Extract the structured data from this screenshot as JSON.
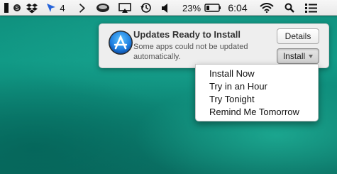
{
  "menubar": {
    "icons": [
      "dropbox-icon",
      "cursor-arrow-icon",
      "forward-icon",
      "coffee-cup-icon",
      "airplay-icon",
      "time-machine-icon",
      "volume-icon",
      "battery-icon",
      "wifi-icon",
      "search-icon",
      "list-icon"
    ],
    "badge_count": "4",
    "battery_percent": "23%",
    "battery_level": 0.23,
    "clock": "6:04"
  },
  "notification": {
    "app_icon": "app-store-icon",
    "title": "Updates Ready to Install",
    "body": "Some apps could not be updated automatically.",
    "details_label": "Details",
    "install_label": "Install"
  },
  "install_menu": {
    "items": [
      {
        "label": "Install Now"
      },
      {
        "label": "Try in an Hour"
      },
      {
        "label": "Try Tonight"
      },
      {
        "label": "Remind Me Tomorrow"
      }
    ]
  },
  "colors": {
    "wallpaper": "#119a86",
    "menubar": "#efefef",
    "app_icon_blue": "#1e7ee0"
  }
}
